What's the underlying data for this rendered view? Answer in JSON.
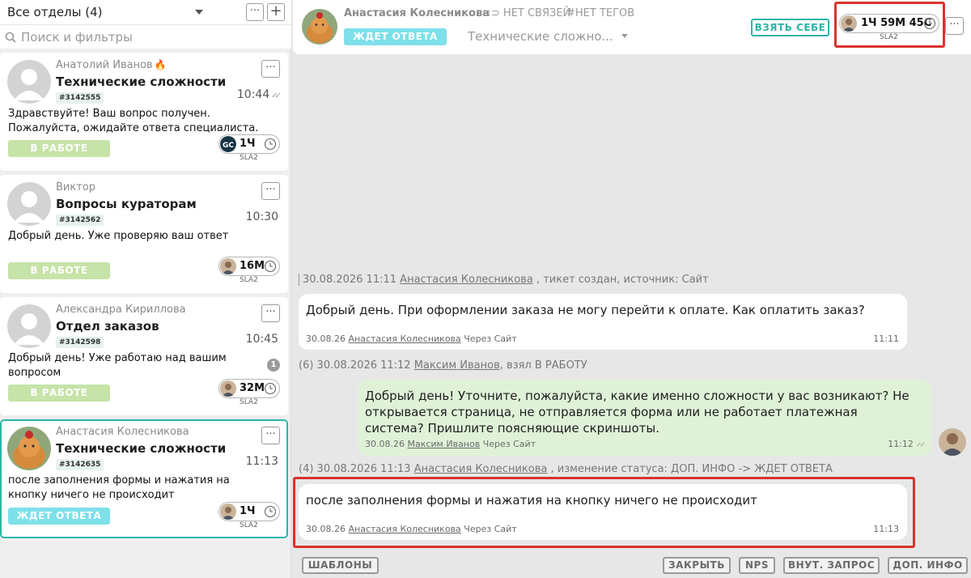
{
  "left_panel": {
    "department_selector": "Все отделы (4)",
    "more_label": "···",
    "add_label": "+",
    "search_placeholder": "Поиск и фильтры",
    "tickets": [
      {
        "author": "Анатолий Иванов",
        "flag_icon": "fire-icon",
        "subject": "Технические сложности",
        "id": "#3142555",
        "time": "10:44",
        "read_state": "double-check",
        "message": "Здравствуйте! Ваш вопрос получен. Пожалуйста, ожидайте ответа специалиста.",
        "status": "В РАБОТЕ",
        "sla_value": "1Ч",
        "sla_avatar": "gc-logo",
        "sla_label": "SLA2"
      },
      {
        "author": "Виктор",
        "subject": "Вопросы кураторам",
        "id": "#3142562",
        "time": "10:30",
        "message": "Добрый день. Уже проверяю ваш ответ",
        "status": "В РАБОТЕ",
        "sla_value": "16М",
        "sla_label": "SLA2"
      },
      {
        "author": "Александра Кириллова",
        "subject": "Отдел заказов",
        "id": "#3142598",
        "time": "10:45",
        "message": "Добрый день! Уже работаю над вашим вопросом",
        "unread_count": "1",
        "status": "В РАБОТЕ",
        "sla_value": "32М",
        "sla_label": "SLA2"
      },
      {
        "author": "Анастасия Колесникова",
        "subject": "Технические сложности",
        "id": "#3142635",
        "time": "11:13",
        "message": "после заполнения формы и нажатия на кнопку ничего не происходит",
        "status": "ЖДЕТ ОТВЕТА",
        "sla_value": "1Ч",
        "sla_label": "SLA2",
        "active": true
      }
    ]
  },
  "header": {
    "client_name": "Анастасия Колесникова",
    "links": "НЕТ СВЯЗЕЙ",
    "tags": "#НЕТ ТЕГОВ",
    "status": "ЖДЕТ ОТВЕТА",
    "category": "Технические сложно...",
    "take_button": "ВЗЯТЬ СЕБЕ",
    "sla_value": "1Ч 59М 45С",
    "sla_label": "SLA2",
    "more_label": "···"
  },
  "chat": {
    "events": [
      {
        "prefix": "30.08.2026 11:11",
        "user": "Анастасия Колесникова",
        "suffix": " , тикет создан, источник: Сайт"
      },
      {
        "prefix": "(6) 30.08.2026 11:12",
        "user": "Максим Иванов",
        "suffix": ", взял В РАБОТУ"
      },
      {
        "prefix": "(4) 30.08.2026 11:13",
        "user": "Анастасия Колесникова",
        "suffix": " , изменение статуса: ДОП. ИНФО -> ЖДЕТ ОТВЕТА"
      }
    ],
    "messages": [
      {
        "text": "Добрый день. При оформлении заказа не могу перейти к оплате. Как оплатить заказ?",
        "date": "30.08.26",
        "author": "Анастасия Колесникова",
        "via": "Через Сайт",
        "time": "11:11"
      },
      {
        "text": "Добрый день! Уточните, пожалуйста, какие именно сложности у вас возникают? Не открывается страница, не отправляется форма или не работает платежная система? Пришлите поясняющие скриншоты.",
        "date": "30.08.26",
        "author": "Максим Иванов",
        "via": "Через Сайт",
        "time": "11:12"
      },
      {
        "text": "после заполнения формы и нажатия на кнопку ничего не происходит",
        "date": "30.08.26",
        "author": "Анастасия Колесникова",
        "via": "Через Сайт",
        "time": "11:13"
      }
    ]
  },
  "footer": {
    "templates": "ШАБЛОНЫ",
    "close": "ЗАКРЫТЬ",
    "nps": "NPS",
    "internal_request": "ВНУТ. ЗАПРОС",
    "extra_info": "ДОП. ИНФО"
  },
  "colors": {
    "accent_teal": "#2bb6a6",
    "status_in_work": "#c6e3a8",
    "status_waiting": "#7ee0ea",
    "outgoing_bubble": "#dff2d8",
    "highlight_red": "#d9332e"
  }
}
